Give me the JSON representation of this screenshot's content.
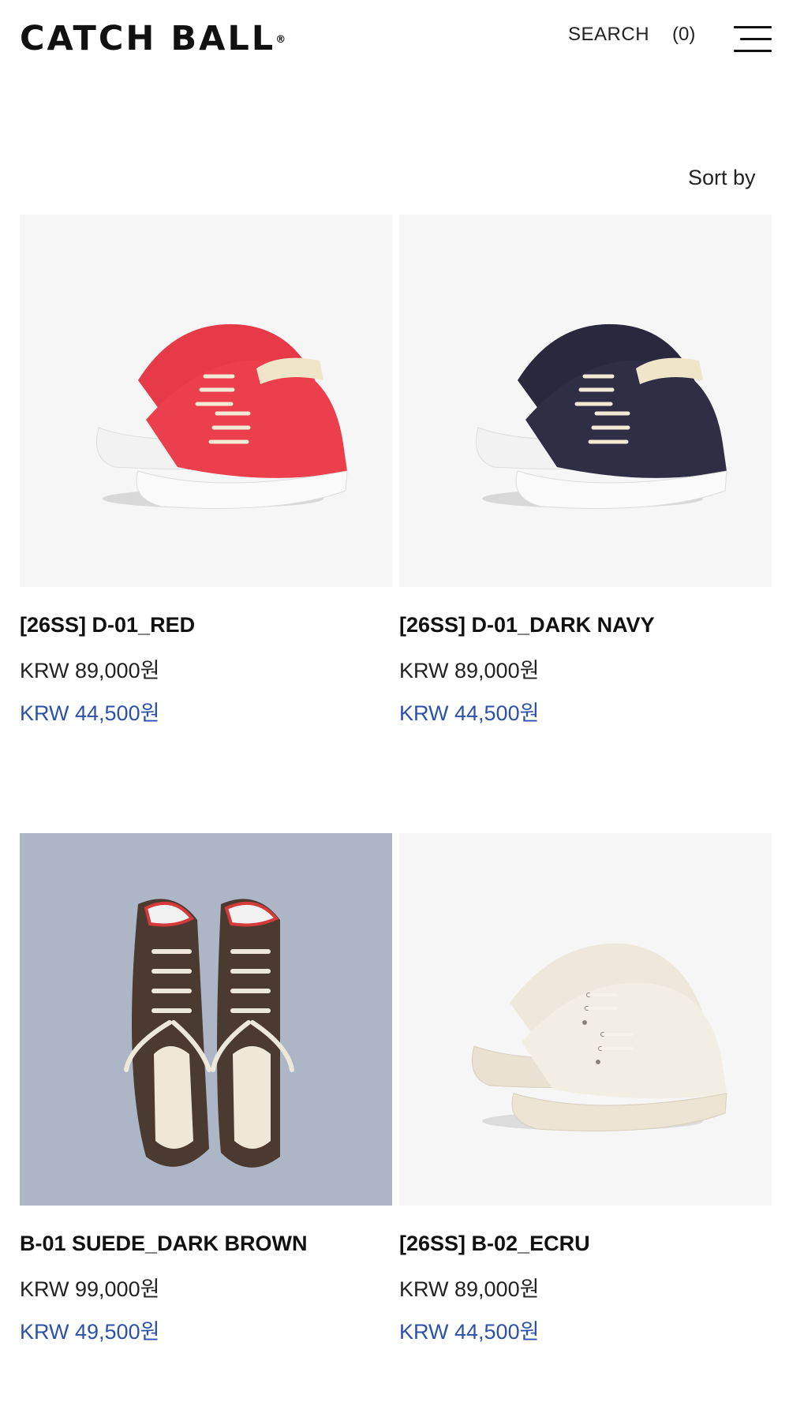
{
  "header": {
    "logo": "CATCH BALL",
    "logo_mark": "®",
    "search_label": "SEARCH",
    "cart_label": "(0)",
    "menu_icon": "hamburger-menu-icon"
  },
  "sort": {
    "label": "Sort by"
  },
  "products": [
    {
      "name": "[26SS] D-01_RED",
      "price": "KRW 89,000원",
      "sale_price": "KRW 44,500원",
      "image": "red low-top canvas sneakers",
      "color": "#e83a4a"
    },
    {
      "name": "[26SS] D-01_DARK NAVY",
      "price": "KRW 89,000원",
      "sale_price": "KRW 44,500원",
      "image": "dark navy low-top canvas sneakers",
      "color": "#2c2a3e"
    },
    {
      "name": "B-01 SUEDE_DARK BROWN",
      "price": "KRW 99,000원",
      "sale_price": "KRW 49,500원",
      "image": "dark brown suede sneakers top view",
      "color": "#4a3a30"
    },
    {
      "name": "[26SS] B-02_ECRU",
      "price": "KRW 89,000원",
      "sale_price": "KRW 44,500원",
      "image": "ecru low-top canvas sneakers",
      "color": "#efe9dd"
    }
  ],
  "colors": {
    "sale_price": "#2b52a8",
    "image_bg": "#f6f6f6",
    "image_bg_alt": "#acb6c7"
  }
}
